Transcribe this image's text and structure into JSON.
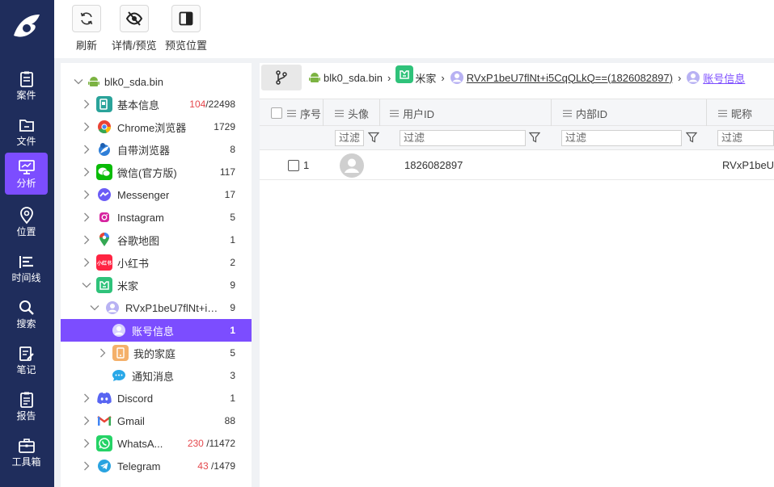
{
  "toolbar": {
    "refresh_label": "刷新",
    "details_label": "详情/预览",
    "preview_pos_label": "预览位置"
  },
  "nav": {
    "items": [
      {
        "label": "案件",
        "icon": "clipboard-icon"
      },
      {
        "label": "文件",
        "icon": "folder-icon"
      },
      {
        "label": "分析",
        "icon": "monitor-icon"
      },
      {
        "label": "位置",
        "icon": "location-pin-icon"
      },
      {
        "label": "时间线",
        "icon": "timeline-icon"
      },
      {
        "label": "搜索",
        "icon": "search-icon"
      },
      {
        "label": "笔记",
        "icon": "note-edit-icon"
      },
      {
        "label": "报告",
        "icon": "report-icon"
      },
      {
        "label": "工具箱",
        "icon": "toolbox-icon"
      }
    ],
    "active_index": 2
  },
  "tree": {
    "root": {
      "label": "blk0_sda.bin"
    },
    "items": [
      {
        "label": "基本信息",
        "count_red": "104",
        "count_total": "/22498"
      },
      {
        "label": "Chrome浏览器",
        "count": "1729"
      },
      {
        "label": "自带浏览器",
        "count": "8"
      },
      {
        "label": "微信(官方版)",
        "count": "117"
      },
      {
        "label": "Messenger",
        "count": "17"
      },
      {
        "label": "Instagram",
        "count": "5"
      },
      {
        "label": "谷歌地图",
        "count": "1"
      },
      {
        "label": "小红书",
        "count": "2",
        "icon_text": "小红书"
      },
      {
        "label": "米家",
        "count": "9"
      },
      {
        "label": "RVxP1beU7flNt+i5...",
        "count": "9"
      },
      {
        "label": "账号信息",
        "count": "1"
      },
      {
        "label": "我的家庭",
        "count": "5"
      },
      {
        "label": "通知消息",
        "count": "3"
      },
      {
        "label": "Discord",
        "count": "1"
      },
      {
        "label": "Gmail",
        "count": "88"
      },
      {
        "label": "WhatsA...",
        "count_red": "230",
        "count_total": "/11472"
      },
      {
        "label": "Telegram",
        "count_red": "43",
        "count_total": "/1479"
      }
    ]
  },
  "breadcrumb": {
    "items": [
      "blk0_sda.bin",
      "米家",
      "RVxP1beU7flNt+i5CqQLkQ==(1826082897)",
      "账号信息"
    ]
  },
  "table": {
    "columns": [
      "序号",
      "头像",
      "用户ID",
      "内部ID",
      "昵称"
    ],
    "filter_placeholder": "过滤",
    "rows": [
      {
        "index": "1",
        "user_id": "1826082897",
        "internal_id": "",
        "nickname": "RVxP1beU"
      }
    ]
  },
  "colors": {
    "nav_bg": "#1f2d5c",
    "accent": "#7c4dff",
    "count_red": "#e5484d"
  }
}
